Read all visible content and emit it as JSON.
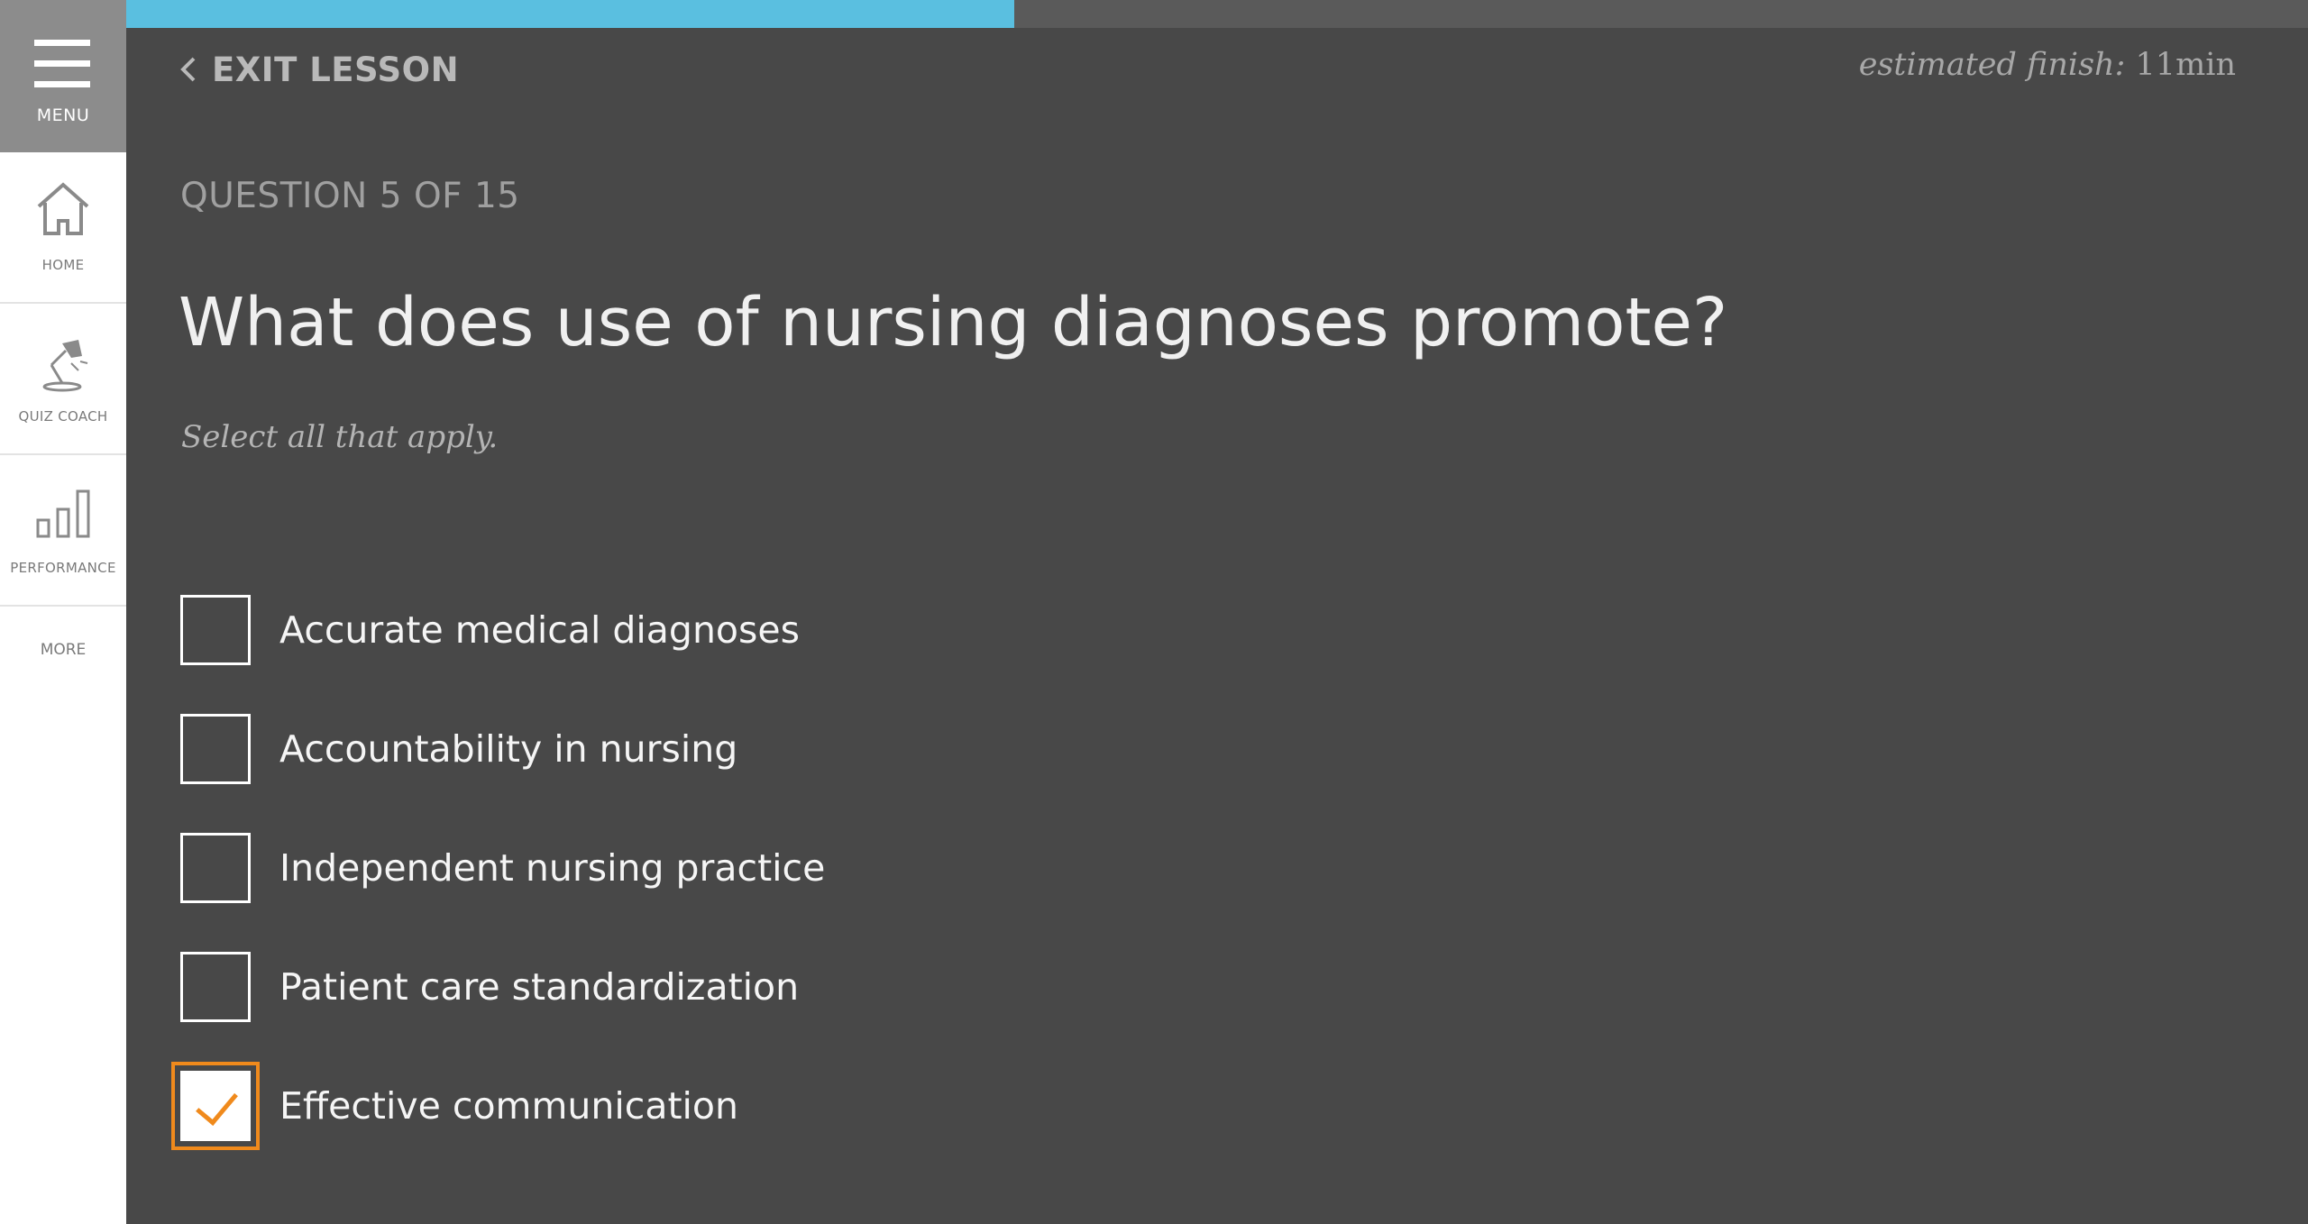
{
  "sidebar": {
    "menu_label": "MENU",
    "items": [
      {
        "label": "HOME",
        "icon": "home-icon"
      },
      {
        "label": "QUIZ COACH",
        "icon": "desk-lamp-icon"
      },
      {
        "label": "PERFORMANCE",
        "icon": "bar-chart-icon"
      }
    ],
    "more_label": "MORE"
  },
  "progress": {
    "fraction": 0.407,
    "color": "#5abfe0"
  },
  "header": {
    "exit_label": "EXIT LESSON",
    "estimate_key": "estimated finish:",
    "estimate_value": "11min"
  },
  "question": {
    "counter": "QUESTION 5 OF 15",
    "title": "What does use of nursing diagnoses promote?",
    "hint": "Select all that apply.",
    "options": [
      {
        "label": "Accurate medical diagnoses",
        "checked": false
      },
      {
        "label": "Accountability in nursing",
        "checked": false
      },
      {
        "label": "Independent nursing practice",
        "checked": false
      },
      {
        "label": "Patient care standardization",
        "checked": false
      },
      {
        "label": "Effective communication",
        "checked": true
      }
    ]
  },
  "colors": {
    "background": "#484848",
    "accent": "#f08a1c",
    "progress": "#5abfe0"
  }
}
